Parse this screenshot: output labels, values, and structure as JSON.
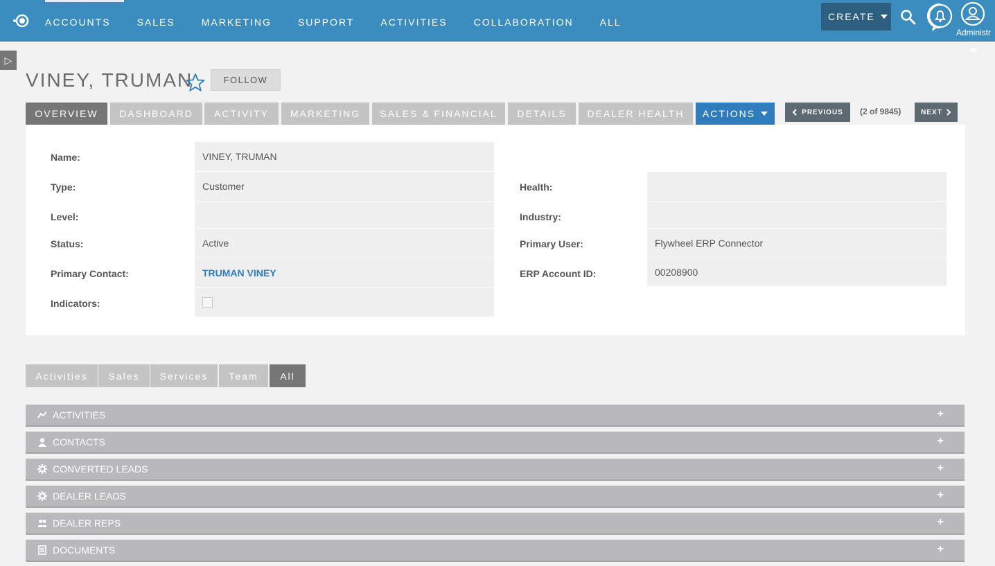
{
  "nav": {
    "items": [
      {
        "label": "ACCOUNTS"
      },
      {
        "label": "SALES"
      },
      {
        "label": "MARKETING"
      },
      {
        "label": "SUPPORT"
      },
      {
        "label": "ACTIVITIES"
      },
      {
        "label": "COLLABORATION"
      },
      {
        "label": "ALL"
      }
    ],
    "create_label": "CREATE",
    "user_label": "Administr"
  },
  "record": {
    "title": "VINEY, TRUMAN",
    "follow_label": "FOLLOW"
  },
  "tabs": [
    {
      "label": "OVERVIEW"
    },
    {
      "label": "DASHBOARD"
    },
    {
      "label": "ACTIVITY"
    },
    {
      "label": "MARKETING"
    },
    {
      "label": "SALES & FINANCIAL"
    },
    {
      "label": "DETAILS"
    },
    {
      "label": "DEALER HEALTH"
    },
    {
      "label": "ACTIONS"
    }
  ],
  "pager": {
    "previous": "PREVIOUS",
    "count": "(2 of 9845)",
    "next": "NEXT"
  },
  "fields": {
    "name": {
      "label": "Name:",
      "value": "VINEY, TRUMAN"
    },
    "type": {
      "label": "Type:",
      "value": "Customer"
    },
    "level": {
      "label": "Level:",
      "value": ""
    },
    "status": {
      "label": "Status:",
      "value": "Active"
    },
    "primary_contact": {
      "label": "Primary Contact:",
      "value": "TRUMAN VINEY"
    },
    "indicators": {
      "label": "Indicators:"
    },
    "health": {
      "label": "Health:",
      "value": ""
    },
    "industry": {
      "label": "Industry:",
      "value": ""
    },
    "primary_user": {
      "label": "Primary User:",
      "value": "Flywheel ERP Connector"
    },
    "erp_account_id": {
      "label": "ERP Account ID:",
      "value": "00208900"
    }
  },
  "subpanel_tabs": [
    {
      "label": "Activities"
    },
    {
      "label": "Sales"
    },
    {
      "label": "Services"
    },
    {
      "label": "Team"
    },
    {
      "label": "All"
    }
  ],
  "subpanels": [
    {
      "label": "ACTIVITIES",
      "icon": "activities-icon"
    },
    {
      "label": "CONTACTS",
      "icon": "person-icon"
    },
    {
      "label": "CONVERTED LEADS",
      "icon": "gear-icon"
    },
    {
      "label": "DEALER LEADS",
      "icon": "gear-icon"
    },
    {
      "label": "DEALER REPS",
      "icon": "people-icon"
    },
    {
      "label": "DOCUMENTS",
      "icon": "document-icon"
    }
  ],
  "colors": {
    "nav_bg": "#3c8dbf",
    "accent": "#2f7dbd",
    "active_tab": "#767676",
    "inactive_tab": "#c4c4c4"
  }
}
